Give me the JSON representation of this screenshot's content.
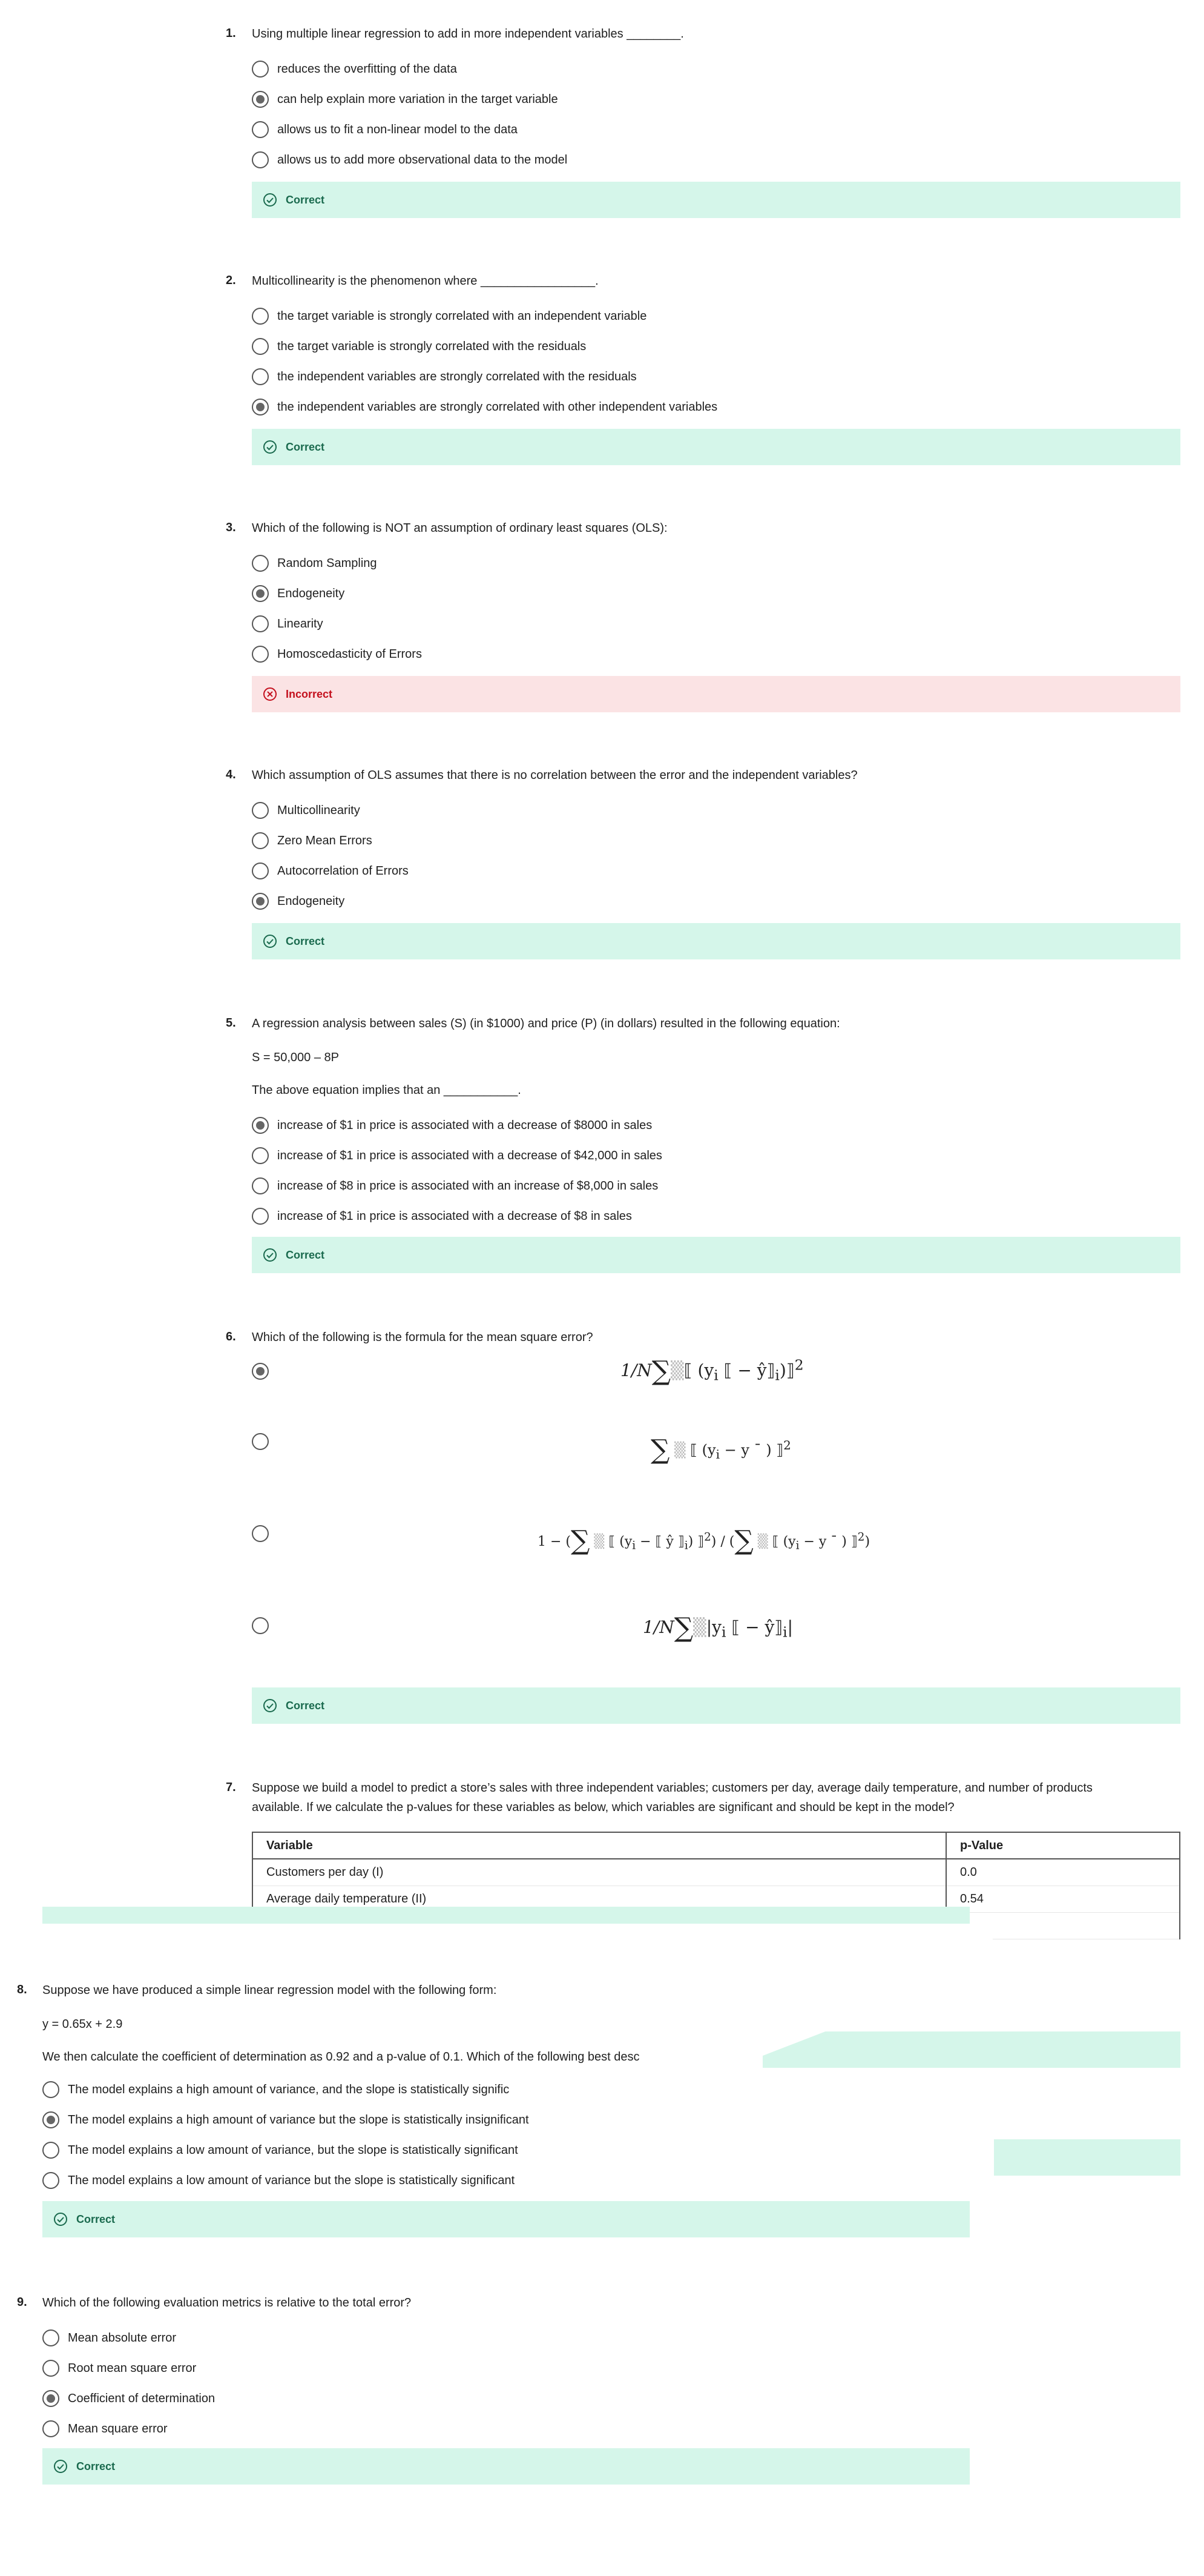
{
  "feedback": {
    "correct": "Correct",
    "incorrect": "Incorrect"
  },
  "q1": {
    "number": "1.",
    "text": "Using multiple linear regression to add in more independent variables ________.",
    "options": [
      "reduces the overfitting of the data",
      "can help explain more variation in the target variable",
      "allows us to fit a non-linear model to the data",
      "allows us to add more observational data to the model"
    ],
    "selected": 1
  },
  "q2": {
    "number": "2.",
    "text": "Multicollinearity is the phenomenon where _________________.",
    "options": [
      "the target variable is strongly correlated with an independent variable",
      "the target variable is strongly correlated with the residuals",
      "the independent variables are strongly correlated with the residuals",
      "the independent variables are strongly correlated with other independent variables"
    ],
    "selected": 3
  },
  "q3": {
    "number": "3.",
    "text": "Which of the following is NOT an assumption of ordinary least squares (OLS):",
    "options": [
      "Random Sampling",
      "Endogeneity",
      "Linearity",
      "Homoscedasticity of Errors"
    ],
    "selected": 1
  },
  "q4": {
    "number": "4.",
    "text": "Which assumption of OLS assumes that there is no correlation between the error and the independent variables?",
    "options": [
      "Multicollinearity",
      "Zero Mean Errors",
      "Autocorrelation of Errors",
      "Endogeneity"
    ],
    "selected": 3
  },
  "q5": {
    "number": "5.",
    "text": "A regression analysis between sales (S) (in $1000) and price (P) (in dollars) resulted in the following equation:",
    "equation": "S = 50,000 – 8P",
    "followup": "The above equation implies that an ___________.",
    "options": [
      "increase of $1 in price is associated with a decrease of $8000 in sales",
      "increase of $1 in price is associated with a decrease of $42,000 in sales",
      "increase of $8 in price is associated with an increase of $8,000 in sales",
      "increase of $1 in price is associated with a decrease of $8 in sales"
    ],
    "selected": 0
  },
  "q6": {
    "number": "6.",
    "text": "Which of the following is the formula for the mean square error?",
    "formulas": {
      "f1_prefix": "1/N",
      "f1_sigma": "∑",
      "f1_body": "⟦ (y",
      "f1_sub": "i",
      "f1_mid": " ⟦ − ŷ⟧",
      "f1_sub2": "i",
      "f1_end": ")⟧",
      "f1_exp": "2",
      "f2_sigma": "∑",
      "f2_body": "⟦ (y",
      "f2_sub": "i",
      "f2_end": " − y ¯ ) ⟧",
      "f2_exp": "2",
      "f3_start": "1 − (",
      "f3_sigma": "∑",
      "f3_body": "⟦ (y",
      "f3_sub": "i",
      "f3_mid": " − ⟦ ŷ ⟧",
      "f3_sub2": "i",
      "f3_end": ") ⟧",
      "f3_exp": "2",
      "f3_div": ") / (",
      "f3_sigma2": "∑",
      "f3_body2": "⟦ (y",
      "f3_sub3": "i",
      "f3_end2": " − y ¯ ) ⟧",
      "f3_exp2": "2",
      "f3_close": ")",
      "f4_prefix": "1/N",
      "f4_sigma": "∑",
      "f4_body": "|y",
      "f4_sub": "i",
      "f4_mid": " ⟦ − ŷ⟧",
      "f4_sub2": "i",
      "f4_end": "|"
    },
    "selected": 0
  },
  "q7": {
    "number": "7.",
    "text_line1": "Suppose we build a model to predict a store’s sales with three independent variables; customers per day, average daily temperature, and number of products",
    "text_line2": "available. If we calculate the p-values for these variables as below, which variables are significant and should be kept in the model?",
    "table": {
      "headers": [
        "Variable",
        "p-Value"
      ],
      "rows": [
        [
          "Customers per day (I)",
          "0.0"
        ],
        [
          "Average daily temperature (II)",
          "0.54"
        ]
      ]
    }
  },
  "q8": {
    "number": "8.",
    "text": "Suppose we have produced a simple linear regression model with the following form:",
    "equation": "y = 0.65x + 2.9",
    "followup": "We then calculate the coefficient of determination as 0.92 and a p-value of 0.1. Which of the following best desc",
    "options": [
      "The model explains a high amount of variance, and the slope is statistically signific",
      "The model explains a high amount of variance but the slope is statistically insignificant",
      "The model explains a low amount of variance, but the slope is statistically significant",
      "The model explains a low amount of variance but the slope is statistically significant"
    ],
    "selected": 1
  },
  "q9": {
    "number": "9.",
    "text": "Which of the following evaluation metrics is relative to the total error?",
    "options": [
      "Mean absolute error",
      "Root mean square error",
      "Coefficient of determination",
      "Mean square error"
    ],
    "selected": 2
  },
  "colors": {
    "correct_bg": "#d5f6ea",
    "correct_text": "#1a6a4e",
    "incorrect_bg": "#fbe3e4",
    "incorrect_text": "#c4111e"
  }
}
